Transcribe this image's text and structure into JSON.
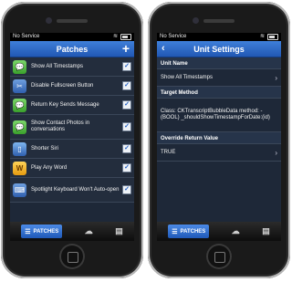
{
  "left": {
    "status": {
      "carrier": "No Service",
      "battery": ""
    },
    "nav": {
      "title": "Patches",
      "add": "+"
    },
    "items": [
      {
        "label": "Show All Timestamps",
        "icon": "message-bubble-icon",
        "checked": true
      },
      {
        "label": "Disable Fullscreen Button",
        "icon": "tools-icon",
        "checked": true
      },
      {
        "label": "Return Key Sends Message",
        "icon": "message-bubble-icon",
        "checked": true
      },
      {
        "label": "Show Contact Photos in conversations",
        "icon": "message-bubble-icon",
        "checked": true
      },
      {
        "label": "Shorter Siri",
        "icon": "phone-icon",
        "checked": true
      },
      {
        "label": "Play Any Word",
        "icon": "words-game-icon",
        "checked": true
      },
      {
        "label": "Spotlight Keyboard Won't Auto-open",
        "icon": "keyboard-icon",
        "checked": true
      }
    ],
    "tabs": {
      "patches": "PATCHES"
    }
  },
  "right": {
    "status": {
      "carrier": "No Service"
    },
    "nav": {
      "title": "Unit Settings",
      "back": "‹"
    },
    "sections": {
      "unit_name": "Unit Name",
      "unit_value": "Show All Timestamps",
      "target_method": "Target Method",
      "method_value": "Class: CKTranscriptBubbleData method: - (BOOL) _shouldShowTimestampForDate:(id)",
      "override": "Override Return Value",
      "override_value": "TRUE"
    },
    "tabs": {
      "patches": "PATCHES"
    }
  },
  "check_mark": "✓",
  "chevron": "›",
  "colors": {
    "accent": "#2158b4",
    "background": "#1e2838"
  }
}
